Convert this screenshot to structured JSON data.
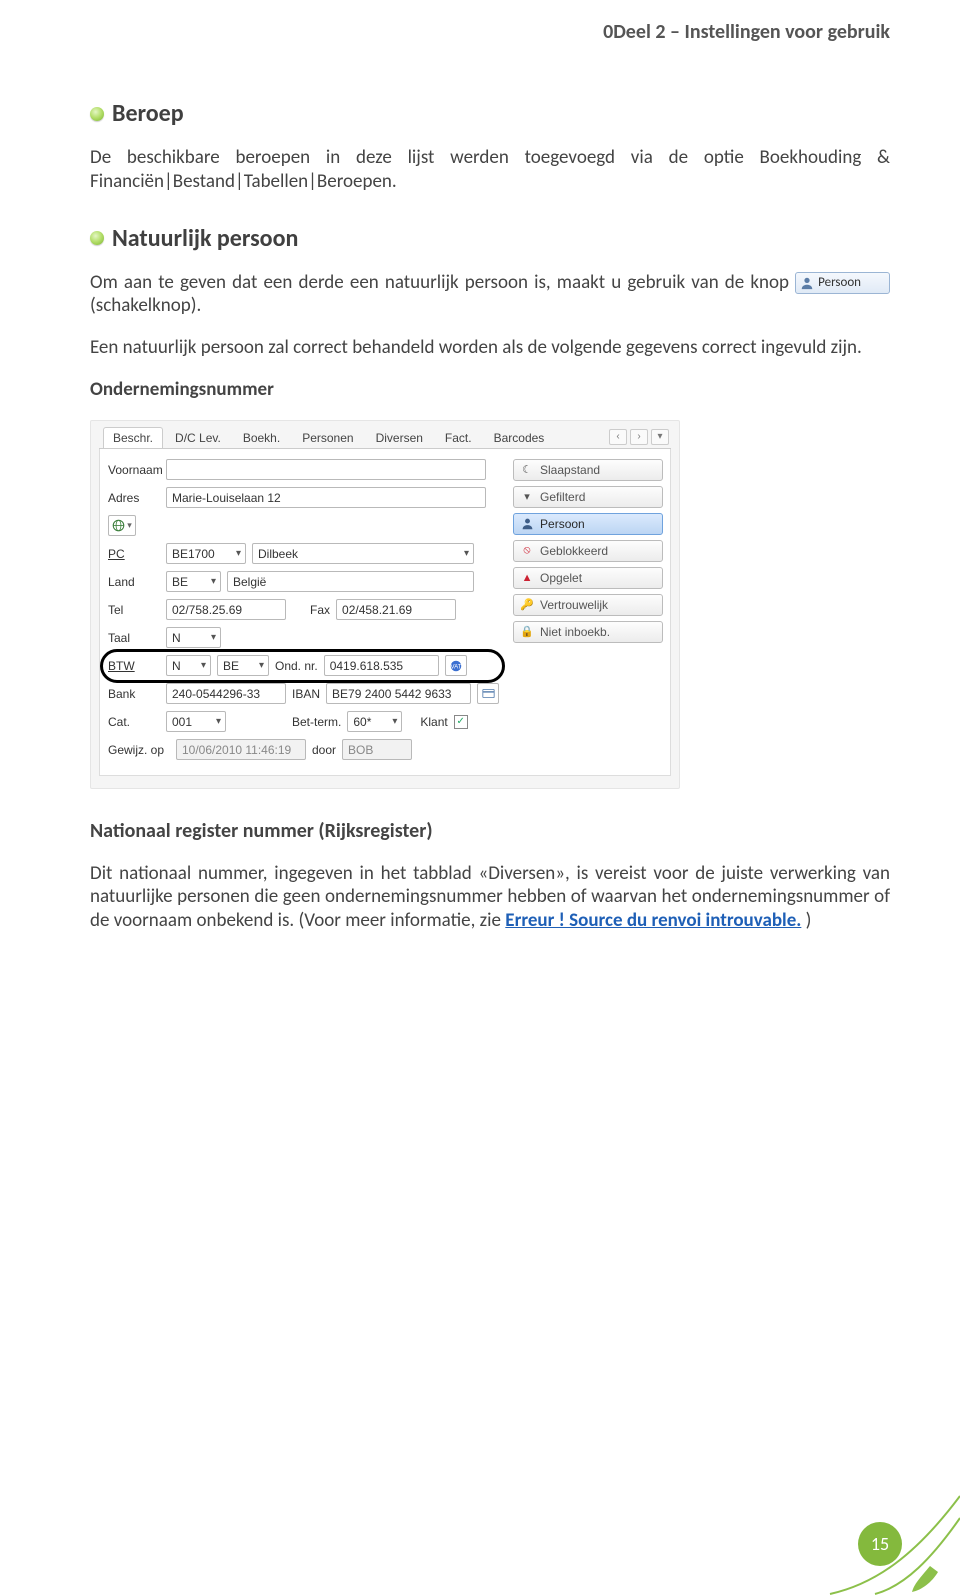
{
  "header": {
    "right": "0Deel 2 – Instellingen voor gebruik"
  },
  "sections": {
    "beroep": {
      "title": "Beroep",
      "para": "De beschikbare beroepen in deze lijst werden toegevoegd via de optie Boekhouding & Financiën|Bestand|Tabellen|Beroepen."
    },
    "natuurlijk": {
      "title": "Natuurlijk persoon",
      "para1_a": "Om aan te geven dat een derde een natuurlijk persoon is, maakt u gebruik van de knop ",
      "inline_btn": "Persoon",
      "para1_b": " (schakelknop).",
      "para2": "Een natuurlijk persoon zal correct behandeld worden als de volgende gegevens correct ingevuld zijn.",
      "subheading": "Ondernemingsnummer"
    },
    "rijks": {
      "title": "Nationaal register nummer (Rijksregister)",
      "para_a": "Dit nationaal nummer, ingegeven in het tabblad «Diversen», is vereist voor de juiste verwerking van natuurlijke personen die geen ondernemingsnummer hebben of waarvan het ondernemingsnummer of de voornaam onbekend is. (Voor meer informatie, zie ",
      "link": "Erreur ! Source du renvoi introuvable.",
      "para_b": ")"
    }
  },
  "panel": {
    "tabs": [
      "Beschr.",
      "D/C Lev.",
      "Boekh.",
      "Personen",
      "Diversen",
      "Fact.",
      "Barcodes"
    ],
    "active_tab_index": 0,
    "labels": {
      "voornaam": "Voornaam",
      "adres": "Adres",
      "pc": "PC",
      "land": "Land",
      "tel": "Tel",
      "fax": "Fax",
      "taal": "Taal",
      "btw": "BTW",
      "ondnr": "Ond. nr.",
      "bank": "Bank",
      "iban": "IBAN",
      "cat": "Cat.",
      "betterm": "Bet-term.",
      "klant": "Klant",
      "gewijz": "Gewijz. op",
      "door": "door"
    },
    "values": {
      "voornaam": "",
      "adres": "Marie-Louiselaan 12",
      "pc": "BE1700",
      "city": "Dilbeek",
      "land_code": "BE",
      "land_name": "België",
      "tel": "02/758.25.69",
      "fax": "02/458.21.69",
      "taal": "N",
      "btw_n": "N",
      "btw_cc": "BE",
      "ondnr": "0419.618.535",
      "bank": "240-0544296-33",
      "iban": "BE79 2400 5442 9633",
      "cat": "001",
      "betterm": "60*",
      "klant_checked": true,
      "gewijz": "10/06/2010 11:46:19",
      "door": "BOB"
    },
    "toggles": [
      {
        "label": "Slaapstand",
        "icon": "moon-icon",
        "active": false
      },
      {
        "label": "Gefilterd",
        "icon": "filter-icon",
        "active": false
      },
      {
        "label": "Persoon",
        "icon": "person-icon",
        "active": true
      },
      {
        "label": "Geblokkeerd",
        "icon": "block-icon",
        "active": false
      },
      {
        "label": "Opgelet",
        "icon": "warning-icon",
        "active": false
      },
      {
        "label": "Vertrouwelijk",
        "icon": "key-icon",
        "active": false
      },
      {
        "label": "Niet inboekb.",
        "icon": "lock-icon",
        "active": false
      }
    ]
  },
  "page_number": "15"
}
